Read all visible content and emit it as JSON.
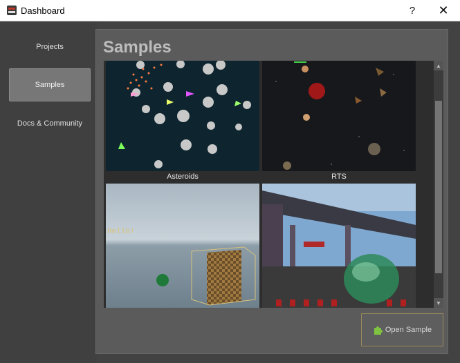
{
  "window": {
    "title": "Dashboard",
    "help_glyph": "?",
    "close_glyph": "✕"
  },
  "sidebar": {
    "items": [
      {
        "label": "Projects",
        "active": false
      },
      {
        "label": "Samples",
        "active": true
      },
      {
        "label": "Docs & Community",
        "active": false
      }
    ]
  },
  "main": {
    "title": "Samples",
    "samples": [
      {
        "label": "Asteroids"
      },
      {
        "label": "RTS"
      },
      {
        "label": ""
      },
      {
        "label": ""
      }
    ],
    "open_button": "Open Sample"
  },
  "scrollbar": {
    "up_glyph": "▲",
    "down_glyph": "▼"
  },
  "colors": {
    "accent_border": "#9a8a5a",
    "active_item": "#777777",
    "puzzle_icon": "#7fc241"
  },
  "hello_text": "Hello!"
}
